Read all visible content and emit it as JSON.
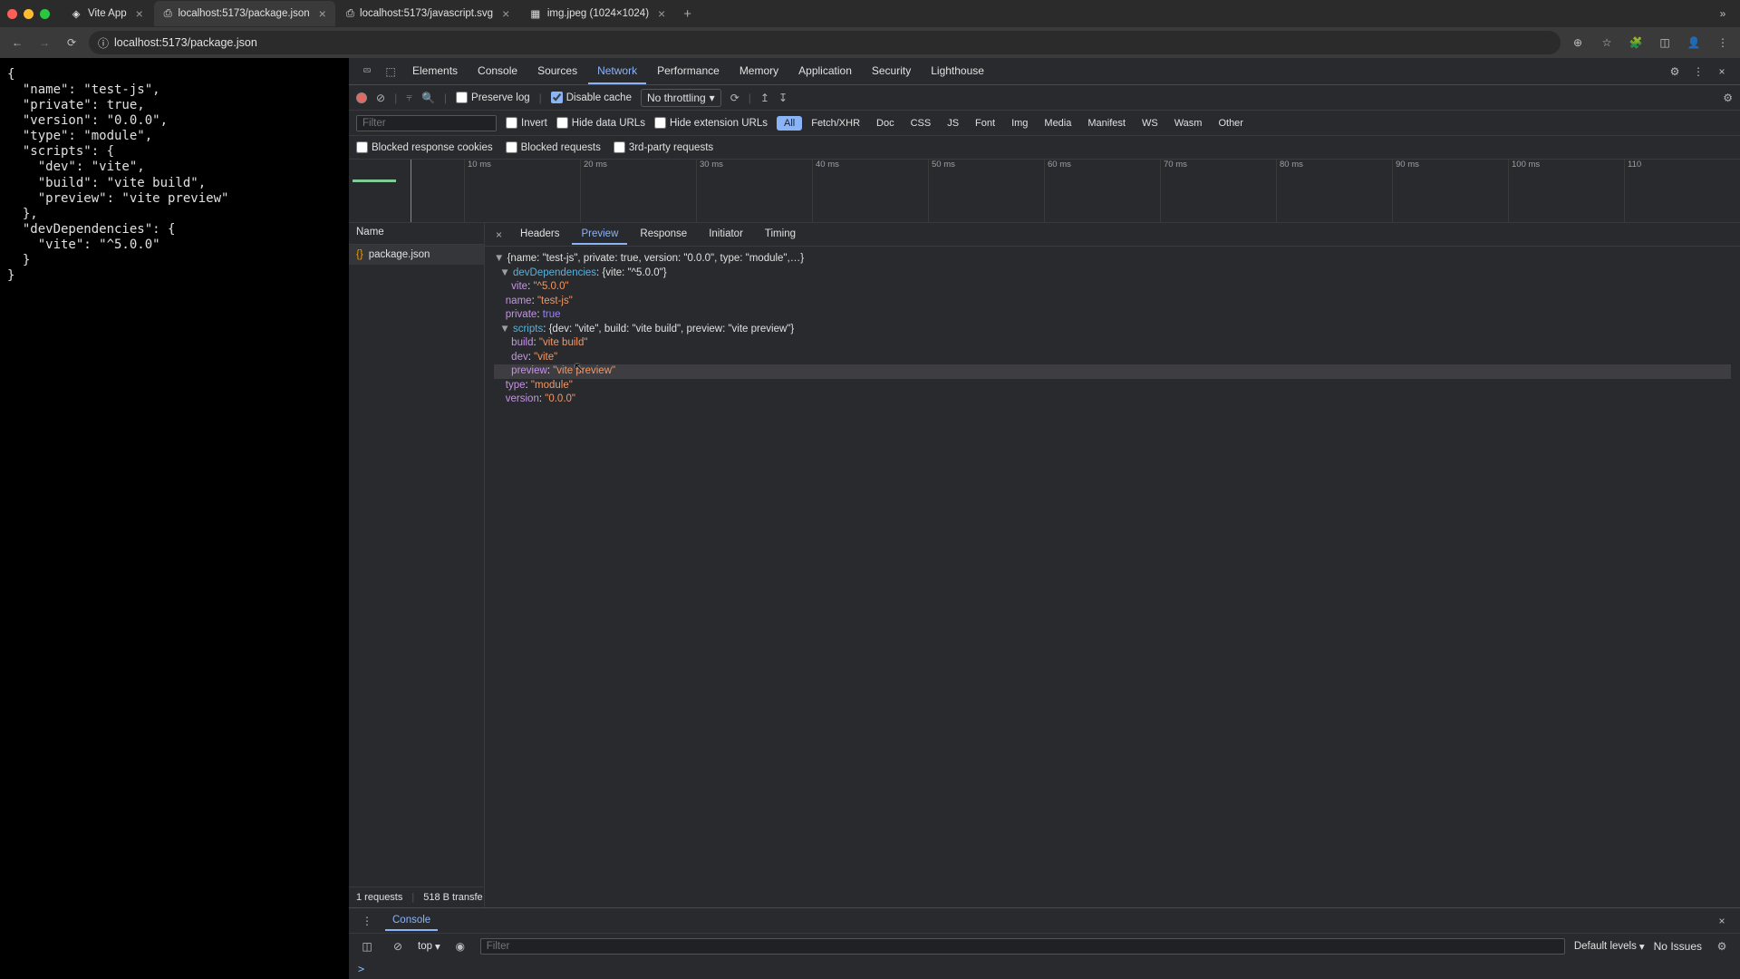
{
  "browser": {
    "tabs": [
      {
        "label": "Vite App"
      },
      {
        "label": "localhost:5173/package.json"
      },
      {
        "label": "localhost:5173/javascript.svg"
      },
      {
        "label": "img.jpeg (1024×1024)"
      }
    ],
    "url": "localhost:5173/package.json"
  },
  "page_content": "{\n  \"name\": \"test-js\",\n  \"private\": true,\n  \"version\": \"0.0.0\",\n  \"type\": \"module\",\n  \"scripts\": {\n    \"dev\": \"vite\",\n    \"build\": \"vite build\",\n    \"preview\": \"vite preview\"\n  },\n  \"devDependencies\": {\n    \"vite\": \"^5.0.0\"\n  }\n}",
  "devtools": {
    "tabs": [
      "Elements",
      "Console",
      "Sources",
      "Network",
      "Performance",
      "Memory",
      "Application",
      "Security",
      "Lighthouse"
    ],
    "active_tab": "Network",
    "network": {
      "preserve_log": "Preserve log",
      "disable_cache": "Disable cache",
      "throttling": "No throttling",
      "filter_placeholder": "Filter",
      "invert": "Invert",
      "hide_data_urls": "Hide data URLs",
      "hide_ext_urls": "Hide extension URLs",
      "type_filters": [
        "All",
        "Fetch/XHR",
        "Doc",
        "CSS",
        "JS",
        "Font",
        "Img",
        "Media",
        "Manifest",
        "WS",
        "Wasm",
        "Other"
      ],
      "blocked_cookies": "Blocked response cookies",
      "blocked_requests": "Blocked requests",
      "third_party": "3rd-party requests",
      "timeline_ticks": [
        "10 ms",
        "20 ms",
        "30 ms",
        "40 ms",
        "50 ms",
        "60 ms",
        "70 ms",
        "80 ms",
        "90 ms",
        "100 ms",
        "110"
      ],
      "name_header": "Name",
      "requests": [
        {
          "name": "package.json"
        }
      ],
      "footer_requests": "1 requests",
      "footer_transfer": "518 B transfe",
      "detail_tabs": [
        "Headers",
        "Preview",
        "Response",
        "Initiator",
        "Timing"
      ],
      "active_detail_tab": "Preview",
      "preview_summary": "{name: \"test-js\", private: true, version: \"0.0.0\", type: \"module\",…}",
      "preview_dev_summary": "{vite: \"^5.0.0\"}",
      "preview_scripts_summary": "{dev: \"vite\", build: \"vite build\", preview: \"vite preview\"}",
      "preview_tree": {
        "devDependencies": {
          "vite": "\"^5.0.0\""
        },
        "name": "\"test-js\"",
        "private": "true",
        "scripts": {
          "build": "\"vite build\"",
          "dev": "\"vite\"",
          "preview": "\"vite preview\""
        },
        "type": "\"module\"",
        "version": "\"0.0.0\""
      }
    },
    "console": {
      "tab": "Console",
      "context": "top",
      "filter_placeholder": "Filter",
      "levels": "Default levels",
      "issues": "No Issues",
      "prompt": ">"
    }
  }
}
